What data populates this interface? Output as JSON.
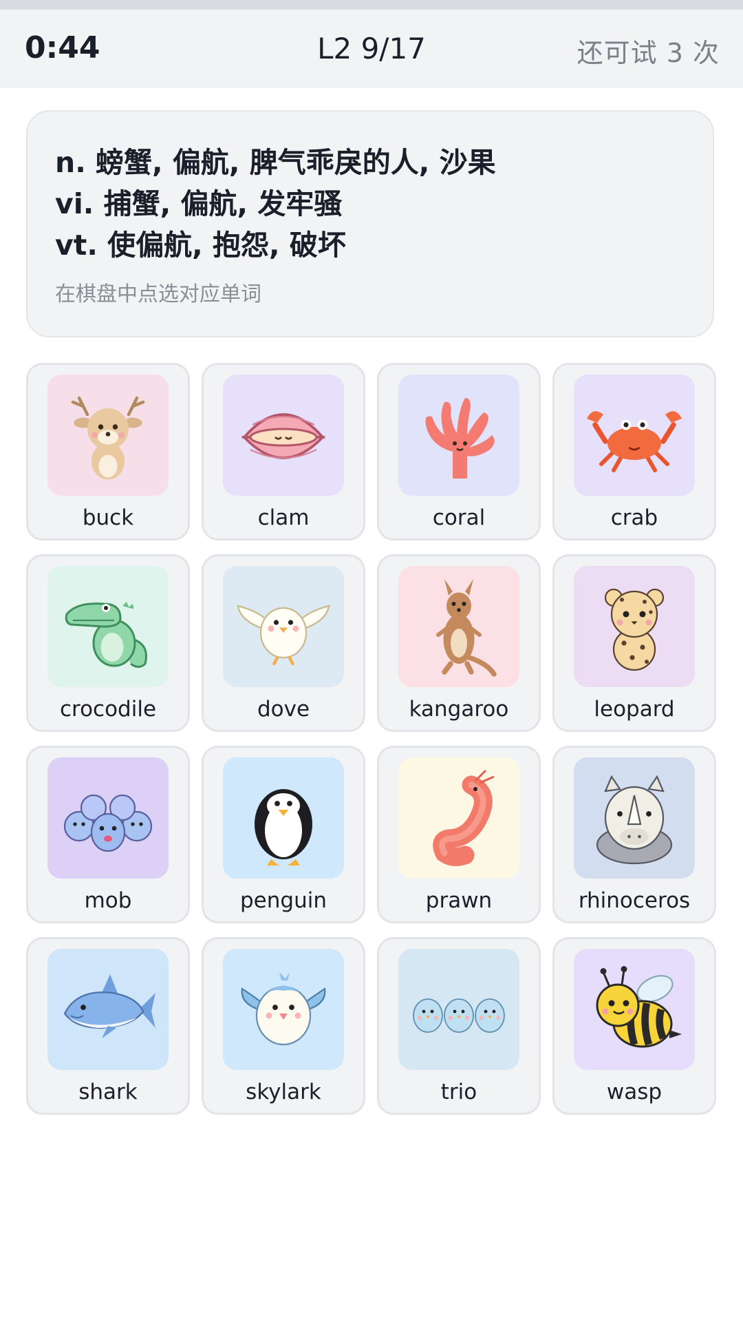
{
  "header": {
    "timer": "0:44",
    "level": "L2 9/17",
    "tries": "还可试 3 次"
  },
  "prompt": {
    "definitions": [
      "n. 螃蟹, 偏航, 脾气乖戾的人, 沙果",
      "vi. 捕蟹, 偏航, 发牢骚",
      "vt. 使偏航, 抱怨, 破坏"
    ],
    "hint": "在棋盘中点选对应单词"
  },
  "cards": [
    {
      "word": "buck",
      "icon": "deer-icon",
      "bg": "#f6dfe9"
    },
    {
      "word": "clam",
      "icon": "clam-icon",
      "bg": "#e6e0fb"
    },
    {
      "word": "coral",
      "icon": "coral-icon",
      "bg": "#e1e3fb"
    },
    {
      "word": "crab",
      "icon": "crab-icon",
      "bg": "#e7e0fb"
    },
    {
      "word": "crocodile",
      "icon": "crocodile-icon",
      "bg": "#dff4ec"
    },
    {
      "word": "dove",
      "icon": "dove-icon",
      "bg": "#dde9f3"
    },
    {
      "word": "kangaroo",
      "icon": "kangaroo-icon",
      "bg": "#fbe0e6"
    },
    {
      "word": "leopard",
      "icon": "leopard-icon",
      "bg": "#ecdcf4"
    },
    {
      "word": "mob",
      "icon": "crowd-icon",
      "bg": "#ddd0f7"
    },
    {
      "word": "penguin",
      "icon": "penguin-icon",
      "bg": "#cfe8fb"
    },
    {
      "word": "prawn",
      "icon": "prawn-icon",
      "bg": "#fdf8e4"
    },
    {
      "word": "rhinoceros",
      "icon": "rhino-icon",
      "bg": "#d2def0"
    },
    {
      "word": "shark",
      "icon": "shark-icon",
      "bg": "#cfe6fa"
    },
    {
      "word": "skylark",
      "icon": "bird-icon",
      "bg": "#cfe8fb"
    },
    {
      "word": "trio",
      "icon": "three-birds-icon",
      "bg": "#d5e7f3"
    },
    {
      "word": "wasp",
      "icon": "bee-icon",
      "bg": "#e6dcfb"
    }
  ]
}
